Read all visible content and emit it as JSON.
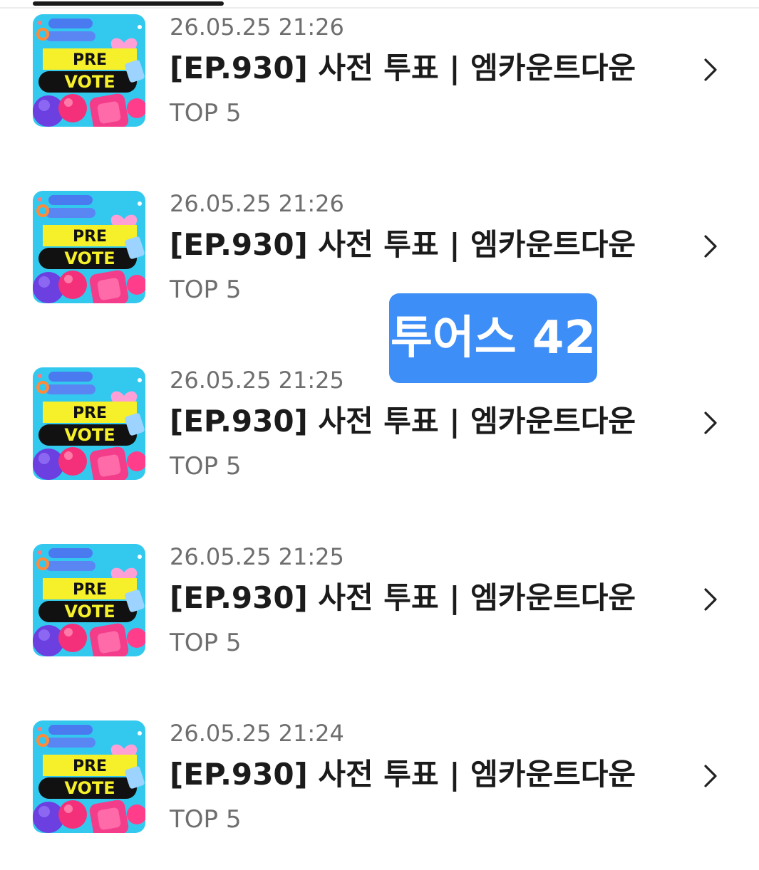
{
  "colors": {
    "badge_bg": "#3d8ef6",
    "title": "#1b1b1b",
    "meta": "#6e6e6e",
    "thumb_bg": "#33c9ef",
    "thumb_band_yellow": "#f5f02a",
    "thumb_band_black": "#111111"
  },
  "thumbnail": {
    "line1": "PRE",
    "line2": "VOTE"
  },
  "items": [
    {
      "date": "26.05.25 21:26",
      "title": "[EP.930] 사전 투표 | 엠카운트다운",
      "subtitle": "TOP 5",
      "icon": "chevron-right-icon"
    },
    {
      "date": "26.05.25 21:26",
      "title": "[EP.930] 사전 투표 | 엠카운트다운",
      "subtitle": "TOP 5",
      "icon": "chevron-right-icon"
    },
    {
      "date": "26.05.25 21:25",
      "title": "[EP.930] 사전 투표 | 엠카운트다운",
      "subtitle": "TOP 5",
      "icon": "chevron-right-icon"
    },
    {
      "date": "26.05.25 21:25",
      "title": "[EP.930] 사전 투표 | 엠카운트다운",
      "subtitle": "TOP 5",
      "icon": "chevron-right-icon"
    },
    {
      "date": "26.05.25 21:24",
      "title": "[EP.930] 사전 투표 | 엠카운트다운",
      "subtitle": "TOP 5",
      "icon": "chevron-right-icon"
    }
  ],
  "overlay": {
    "label": "투어스 42"
  }
}
